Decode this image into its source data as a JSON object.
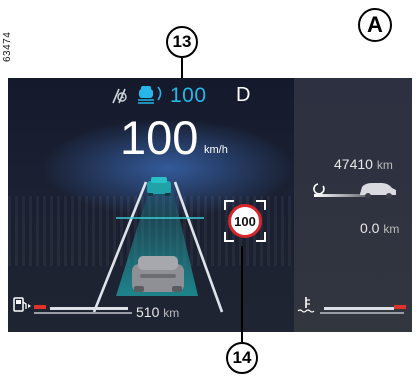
{
  "figure_id": "63474",
  "callouts": {
    "panel": "A",
    "top": "13",
    "bottom": "14"
  },
  "cluster": {
    "speed_limit_setting": "100",
    "gear": "D",
    "speed": "100",
    "speed_unit": "km/h",
    "odometer_value": "47410",
    "odometer_unit": "km",
    "trip_value": "0.0",
    "trip_unit": "km",
    "range_value": "510",
    "range_unit": "km",
    "traffic_sign_speed": "100"
  },
  "colors": {
    "accent_blue": "#27b6e8",
    "lane_teal": "#1fa3a8",
    "sign_red": "#d7262b",
    "warning_red": "#e0322b"
  },
  "icons": [
    "driver-assist-icon",
    "lane-keep-icon",
    "fuel-pump-icon",
    "coolant-temp-icon",
    "eco-loop-icon",
    "car-side-icon"
  ]
}
